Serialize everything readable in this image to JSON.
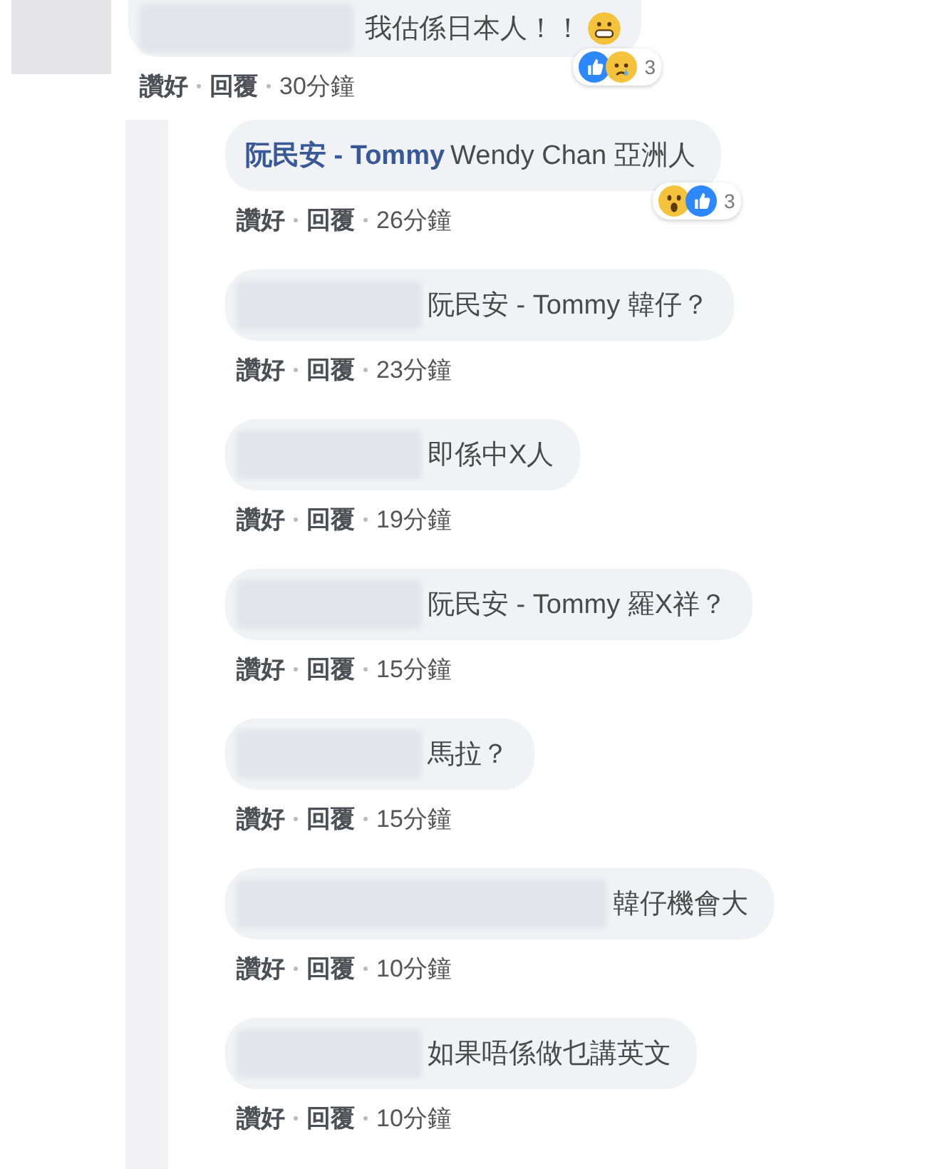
{
  "comment": {
    "name_redacted": true,
    "text": "我估係日本人！！",
    "emoji": true,
    "reactions": {
      "icons": [
        {
          "kind": "like"
        },
        {
          "kind": "sad"
        }
      ],
      "count": "3"
    },
    "actions": {
      "like": "讚好",
      "reply": "回覆",
      "time": "30分鐘"
    }
  },
  "replies": [
    {
      "name_redacted": false,
      "author": "阮民安 - Tommy",
      "text": "Wendy Chan 亞洲人",
      "reactions": {
        "icons": [
          {
            "kind": "wow"
          },
          {
            "kind": "like"
          }
        ],
        "count": "3"
      },
      "actions": {
        "like": "讚好",
        "reply": "回覆",
        "time": "26分鐘"
      }
    },
    {
      "name_redacted": true,
      "text": "阮民安 - Tommy 韓仔？",
      "actions": {
        "like": "讚好",
        "reply": "回覆",
        "time": "23分鐘"
      }
    },
    {
      "name_redacted": true,
      "text": "即係中X人",
      "actions": {
        "like": "讚好",
        "reply": "回覆",
        "time": "19分鐘"
      }
    },
    {
      "name_redacted": true,
      "text": "阮民安 - Tommy 羅X祥？",
      "actions": {
        "like": "讚好",
        "reply": "回覆",
        "time": "15分鐘"
      }
    },
    {
      "name_redacted": true,
      "text": "馬拉？",
      "actions": {
        "like": "讚好",
        "reply": "回覆",
        "time": "15分鐘"
      }
    },
    {
      "name_redacted": true,
      "text": "韓仔機會大",
      "wide_redaction": true,
      "actions": {
        "like": "讚好",
        "reply": "回覆",
        "time": "10分鐘"
      }
    },
    {
      "name_redacted": true,
      "text": "如果唔係做乜講英文",
      "actions": {
        "like": "讚好",
        "reply": "回覆",
        "time": "10分鐘"
      }
    }
  ]
}
